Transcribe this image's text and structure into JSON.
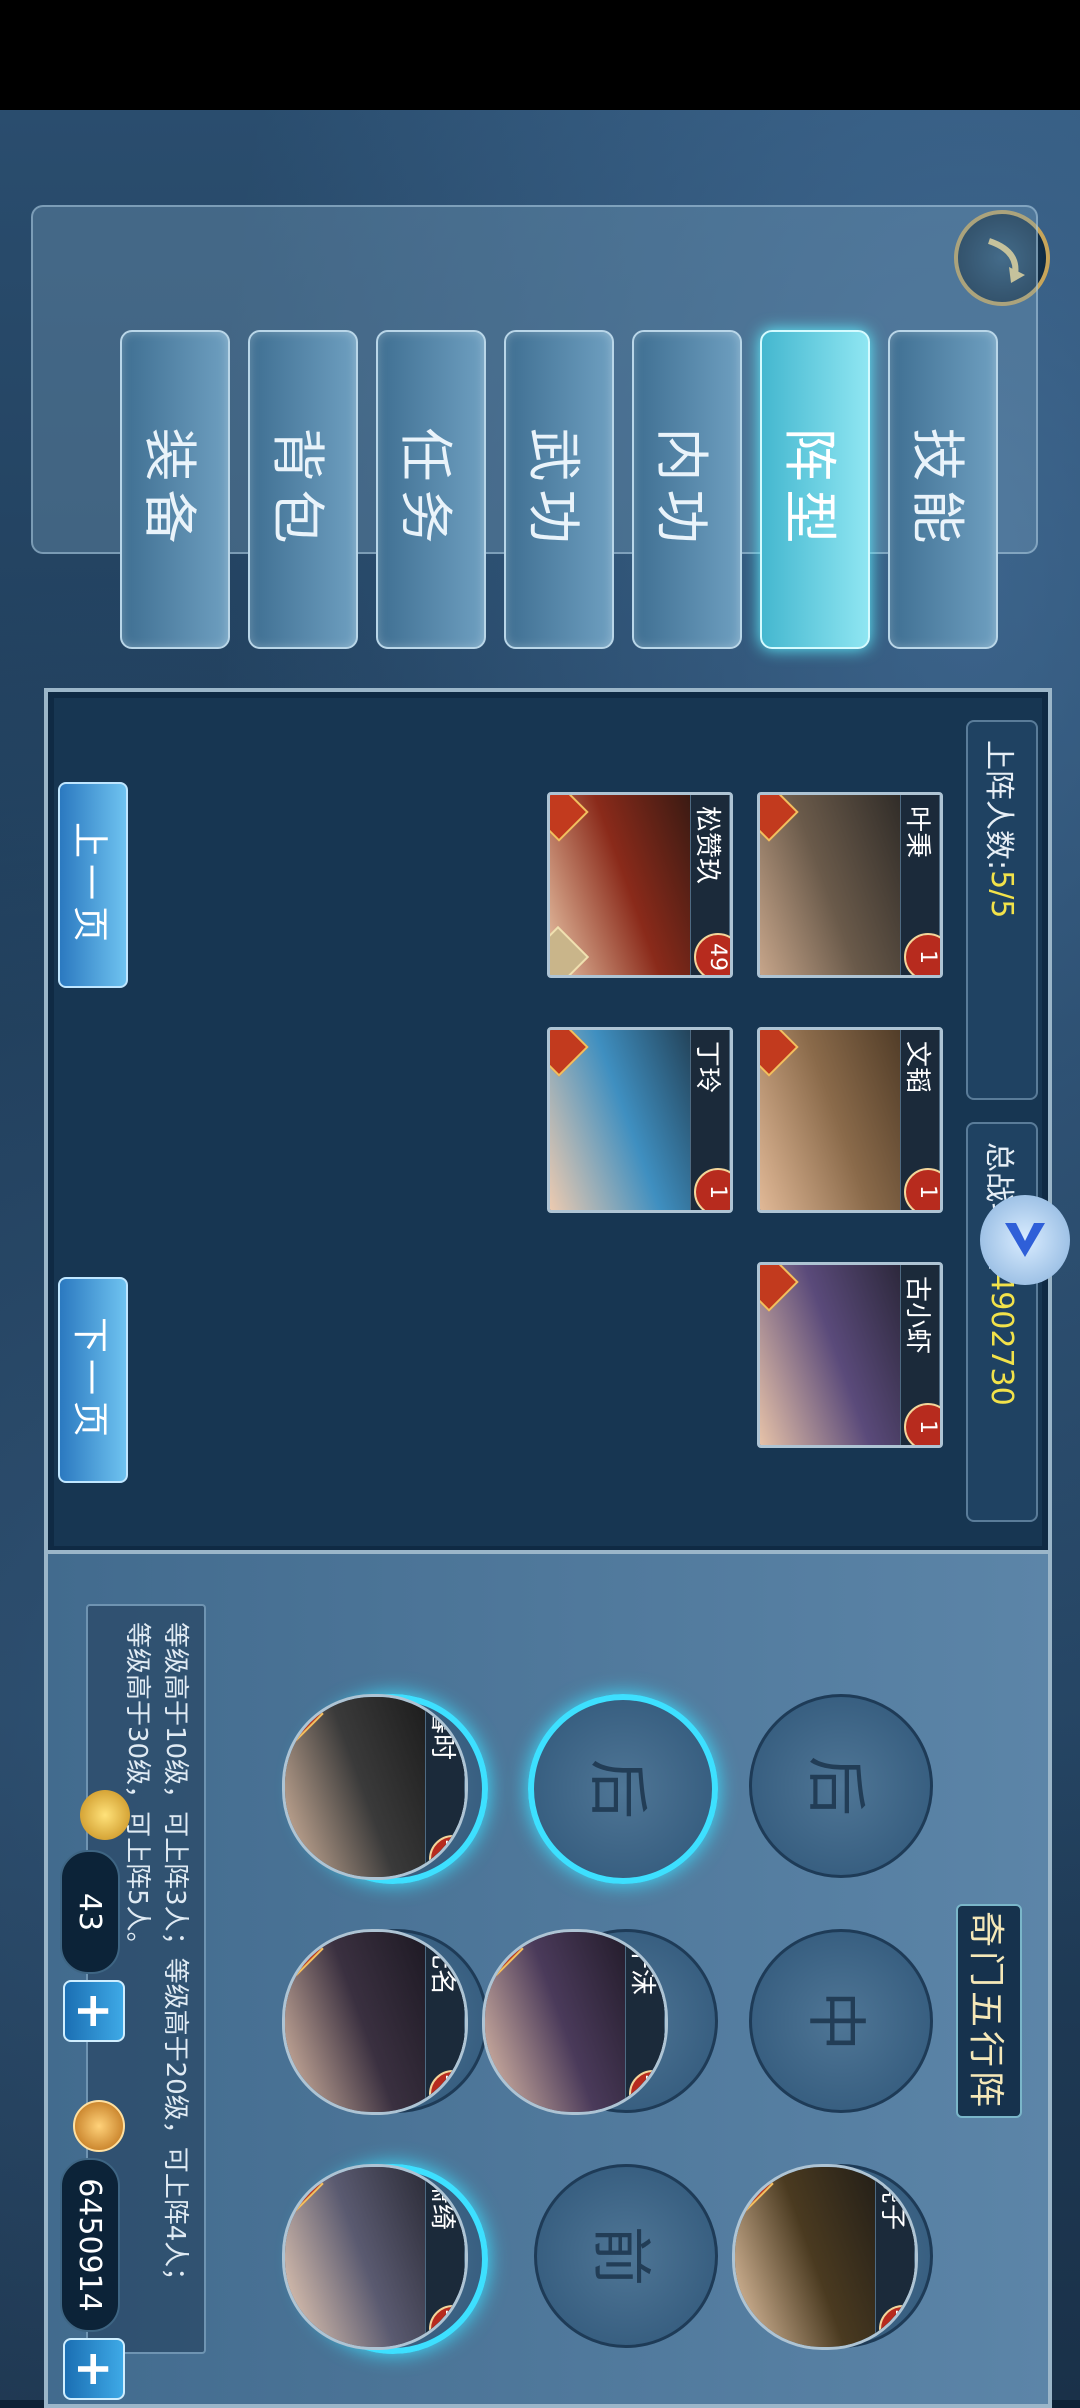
{
  "tabs": [
    {
      "label": "装备"
    },
    {
      "label": "背包"
    },
    {
      "label": "任务"
    },
    {
      "label": "武功"
    },
    {
      "label": "内功"
    },
    {
      "label": "阵型",
      "active": true
    },
    {
      "label": "技能"
    }
  ],
  "roster": {
    "deployed_label": "上阵人数:",
    "deployed_value": "5/5",
    "power_label": "总战斗力:",
    "power_value": "4902730",
    "heroes": [
      {
        "name": "叶秉",
        "level": "1"
      },
      {
        "name": "文韬",
        "level": "1"
      },
      {
        "name": "古小虾",
        "level": "1"
      },
      {
        "name": "松赞玖",
        "level": "49"
      },
      {
        "name": "丁玲",
        "level": "1"
      }
    ],
    "prev_page": "上一页",
    "next_page": "下一页"
  },
  "formation": {
    "title": "奇门五行阵",
    "slot_labels": {
      "back": "后",
      "middle": "中",
      "front": "前"
    },
    "heroes": [
      {
        "name": "暮时",
        "level": "102"
      },
      {
        "name": "千沫",
        "level": "102"
      },
      {
        "name": "无名",
        "level": "102"
      },
      {
        "name": "虎子",
        "level": "100"
      },
      {
        "name": "萧绮",
        "level": "101"
      }
    ],
    "hint_line1": "等级高于10级，可上阵3人；等级高于20级，可上阵4人；",
    "hint_line2": "等级高于30级，可上阵5人。"
  },
  "currency": {
    "ingots": "43",
    "coins": "6450914"
  }
}
